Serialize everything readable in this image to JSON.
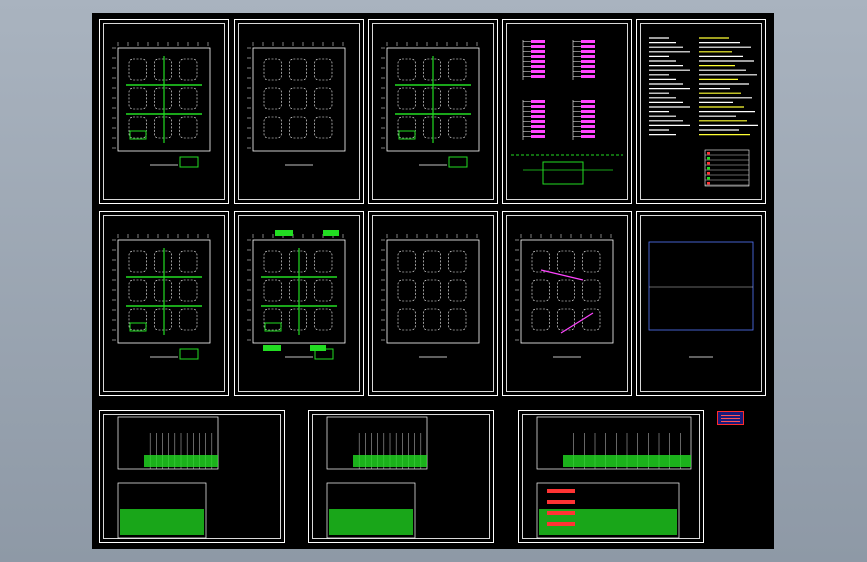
{
  "viewport": {
    "background": "#9aa5b1",
    "canvas_color": "#000000"
  },
  "colors": {
    "sheet_border": "#ffffff",
    "wall": "#ffffff",
    "route": "#22dd22",
    "accent": "#ff44ff",
    "warning": "#ffff33",
    "alert": "#ff3333"
  },
  "sheets": [
    {
      "id": "plan-1",
      "kind": "floorplan",
      "variant": "green-network"
    },
    {
      "id": "plan-2",
      "kind": "floorplan",
      "variant": "plain"
    },
    {
      "id": "plan-3",
      "kind": "floorplan",
      "variant": "green-network"
    },
    {
      "id": "diagram-4",
      "kind": "system-diagram",
      "variant": "magenta"
    },
    {
      "id": "notes-5",
      "kind": "notes",
      "variant": "text"
    },
    {
      "id": "plan-6",
      "kind": "floorplan",
      "variant": "green-network"
    },
    {
      "id": "plan-7",
      "kind": "floorplan",
      "variant": "green-tags"
    },
    {
      "id": "plan-8",
      "kind": "floorplan",
      "variant": "plain"
    },
    {
      "id": "plan-9",
      "kind": "floorplan",
      "variant": "magenta"
    },
    {
      "id": "plan-10",
      "kind": "outline",
      "variant": "blue"
    },
    {
      "id": "table-11",
      "kind": "table",
      "variant": "green"
    },
    {
      "id": "table-12",
      "kind": "table",
      "variant": "green"
    },
    {
      "id": "table-13",
      "kind": "table",
      "variant": "green-detail"
    }
  ]
}
